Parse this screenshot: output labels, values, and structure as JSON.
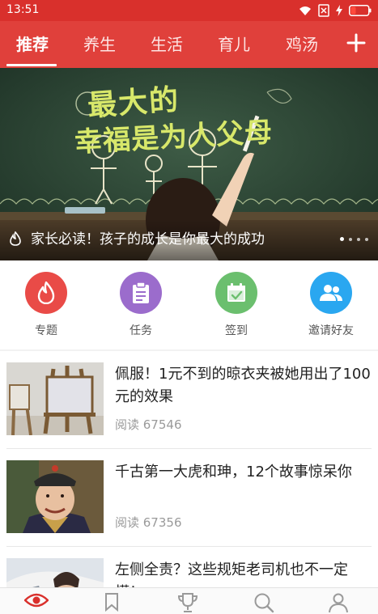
{
  "status_bar": {
    "time": "13:51",
    "icons": [
      "wifi-icon",
      "sim-missing-icon",
      "charging-icon",
      "battery-icon"
    ]
  },
  "tabs": [
    {
      "label": "推荐",
      "active": true
    },
    {
      "label": "养生",
      "active": false
    },
    {
      "label": "生活",
      "active": false
    },
    {
      "label": "育儿",
      "active": false
    },
    {
      "label": "鸡汤",
      "active": false
    }
  ],
  "tab_add_icon": "plus-icon",
  "banner": {
    "board_text_line1": "最大的",
    "board_text_line2": "幸福是为人父母",
    "caption": "家长必读！孩子的成长是你最大的成功",
    "dot_count": 4,
    "active_dot": 0
  },
  "quick_actions": [
    {
      "label": "专题",
      "icon": "flame-icon",
      "color": "#e94b47"
    },
    {
      "label": "任务",
      "icon": "clipboard-icon",
      "color": "#9b6ccc"
    },
    {
      "label": "签到",
      "icon": "calendar-check-icon",
      "color": "#6bbf6e"
    },
    {
      "label": "邀请好友",
      "icon": "people-icon",
      "color": "#2aa7f0"
    }
  ],
  "articles": [
    {
      "title": "佩服！1元不到的晾衣夹被她用出了100元的效果",
      "meta": "阅读 67546",
      "thumb": "easel-image"
    },
    {
      "title": "千古第一大虎和珅，12个故事惊呆你",
      "meta": "阅读 67356",
      "thumb": "portrait-image"
    },
    {
      "title": "左侧全责？这些规矩老司机也不一定懂！",
      "meta": "",
      "thumb": "car-image"
    }
  ],
  "bottom_nav": [
    {
      "icon": "eye-icon",
      "active": true
    },
    {
      "icon": "bookmark-icon",
      "active": false
    },
    {
      "icon": "trophy-icon",
      "active": false
    },
    {
      "icon": "search-icon",
      "active": false
    },
    {
      "icon": "user-icon",
      "active": false
    }
  ],
  "colors": {
    "brand_red": "#e0403b",
    "status_red": "#d9302c",
    "meta_gray": "#9a9a9a"
  }
}
